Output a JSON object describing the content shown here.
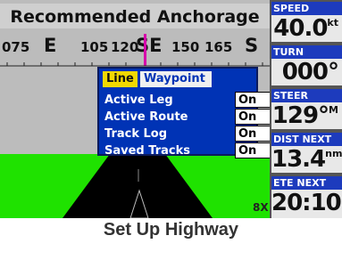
{
  "screen": {
    "title": "Recommended Anchorage",
    "compass": {
      "ticks": [
        "075",
        "E",
        "105",
        "120",
        "SE",
        "150",
        "165",
        "S"
      ]
    },
    "zoom": "8X"
  },
  "popup": {
    "tabs": [
      "Line",
      "Waypoint"
    ],
    "rows": [
      {
        "label": "Active Leg",
        "value": "On"
      },
      {
        "label": "Active Route",
        "value": "On"
      },
      {
        "label": "Track Log",
        "value": "On"
      },
      {
        "label": "Saved Tracks",
        "value": "On"
      }
    ]
  },
  "fields": [
    {
      "label": "SPEED",
      "value": "40.0",
      "unit": "kt"
    },
    {
      "label": "TURN",
      "value": "000°",
      "unit": ""
    },
    {
      "label": "STEER",
      "value": "129°",
      "unit": "M"
    },
    {
      "label": "DIST NEXT",
      "value": "13.4",
      "unit": "nm"
    },
    {
      "label": "ETE NEXT",
      "value": "20:10",
      "unit": ""
    }
  ],
  "caption": "Set Up Highway",
  "colors": {
    "popup_bg": "#0033b5",
    "active_tab": "#f2d800",
    "field_label_bg": "#1d3bbd",
    "ground": "#1fe200",
    "heading_mark": "#d600aa"
  }
}
